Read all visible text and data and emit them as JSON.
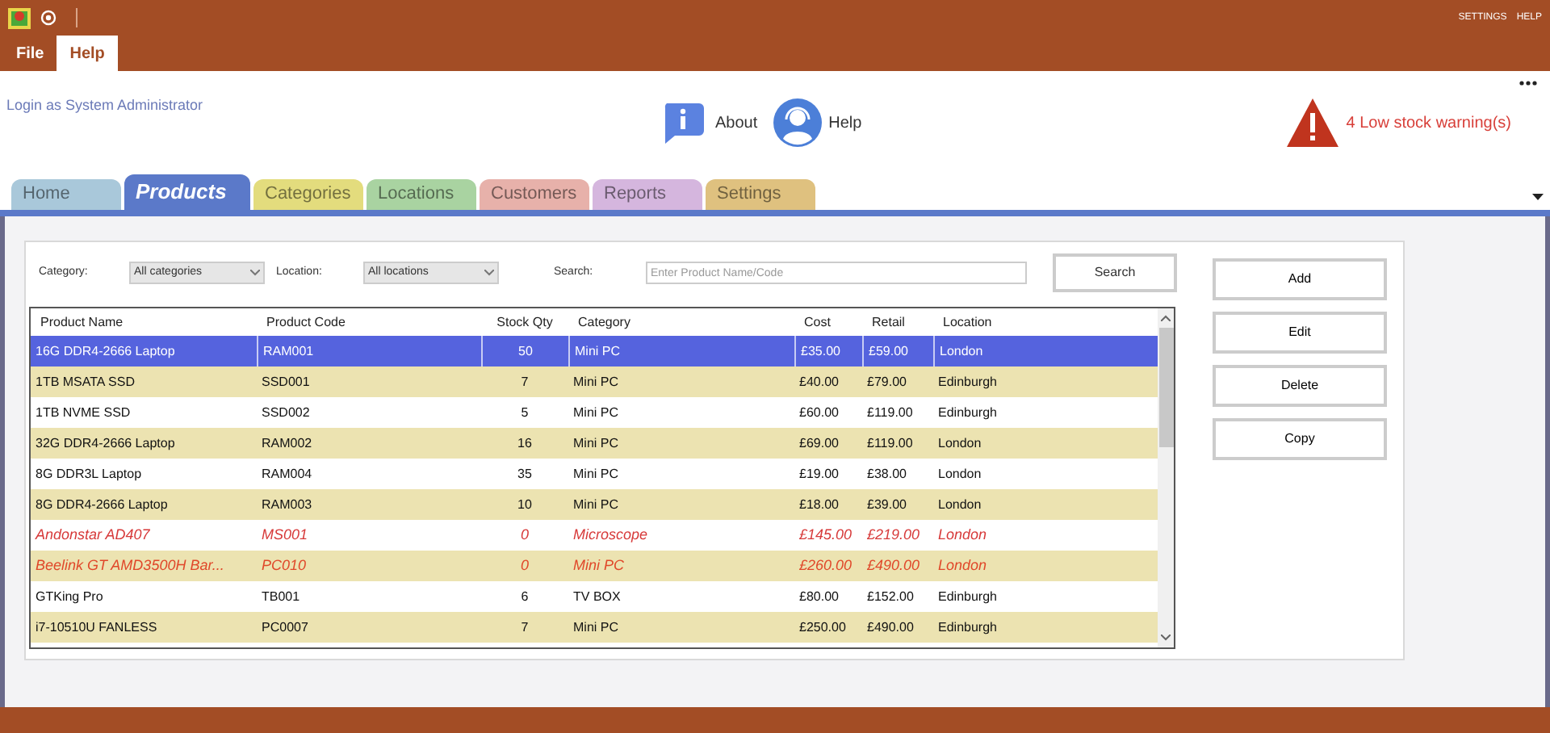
{
  "title_bar": {
    "links": [
      "SETTINGS",
      "HELP"
    ]
  },
  "menu": [
    {
      "label": "File",
      "selected": false
    },
    {
      "label": "Help",
      "selected": true
    }
  ],
  "header": {
    "login": "Login as System Administrator",
    "about": "About",
    "help": "Help",
    "warning": "4 Low stock warning(s)"
  },
  "tabs": [
    {
      "label": "Home",
      "selected": false,
      "color": "#a9c8da"
    },
    {
      "label": "Products",
      "selected": true,
      "color": "#5b79c9"
    },
    {
      "label": "Categories",
      "selected": false,
      "color": "#e3dc7d"
    },
    {
      "label": "Locations",
      "selected": false,
      "color": "#a9d3a1"
    },
    {
      "label": "Customers",
      "selected": false,
      "color": "#e7b1aa"
    },
    {
      "label": "Reports",
      "selected": false,
      "color": "#d5b6de"
    },
    {
      "label": "Settings",
      "selected": false,
      "color": "#dfc17f"
    }
  ],
  "filters": {
    "category_label": "Category:",
    "category": "All categories",
    "location_label": "Location:",
    "location": "All locations",
    "search_label": "Search:",
    "search_placeholder": "Enter Product Name/Code",
    "search_button": "Search"
  },
  "table": {
    "columns": [
      "Product Name",
      "Product Code",
      "Stock Qty",
      "Category",
      "Cost",
      "Retail",
      "Location"
    ],
    "rows": [
      {
        "cells": [
          "16G DDR4-2666 Laptop",
          "RAM001",
          "50",
          "Mini PC",
          "£35.00",
          "£59.00",
          "London"
        ],
        "selected": true,
        "low_stock": false
      },
      {
        "cells": [
          "1TB MSATA SSD",
          "SSD001",
          "7",
          "Mini PC",
          "£40.00",
          "£79.00",
          "Edinburgh"
        ],
        "selected": false,
        "low_stock": false
      },
      {
        "cells": [
          "1TB NVME SSD",
          "SSD002",
          "5",
          "Mini PC",
          "£60.00",
          "£119.00",
          "Edinburgh"
        ],
        "selected": false,
        "low_stock": false
      },
      {
        "cells": [
          "32G DDR4-2666 Laptop",
          "RAM002",
          "16",
          "Mini PC",
          "£69.00",
          "£119.00",
          "London"
        ],
        "selected": false,
        "low_stock": false
      },
      {
        "cells": [
          "8G DDR3L Laptop",
          "RAM004",
          "35",
          "Mini PC",
          "£19.00",
          "£38.00",
          "London"
        ],
        "selected": false,
        "low_stock": false
      },
      {
        "cells": [
          "8G DDR4-2666 Laptop",
          "RAM003",
          "10",
          "Mini PC",
          "£18.00",
          "£39.00",
          "London"
        ],
        "selected": false,
        "low_stock": false
      },
      {
        "cells": [
          "Andonstar AD407",
          "MS001",
          "0",
          "Microscope",
          "£145.00",
          "£219.00",
          "London"
        ],
        "selected": false,
        "low_stock": true
      },
      {
        "cells": [
          "Beelink GT AMD3500H Bar...",
          "PC010",
          "0",
          "Mini PC",
          "£260.00",
          "£490.00",
          "London"
        ],
        "selected": false,
        "low_stock": true
      },
      {
        "cells": [
          "GTKing Pro",
          "TB001",
          "6",
          "TV BOX",
          "£80.00",
          "£152.00",
          "Edinburgh"
        ],
        "selected": false,
        "low_stock": false
      },
      {
        "cells": [
          "i7-10510U FANLESS",
          "PC0007",
          "7",
          "Mini PC",
          "£250.00",
          "£490.00",
          "Edinburgh"
        ],
        "selected": false,
        "low_stock": false
      }
    ]
  },
  "actions": [
    "Add",
    "Edit",
    "Delete",
    "Copy"
  ]
}
